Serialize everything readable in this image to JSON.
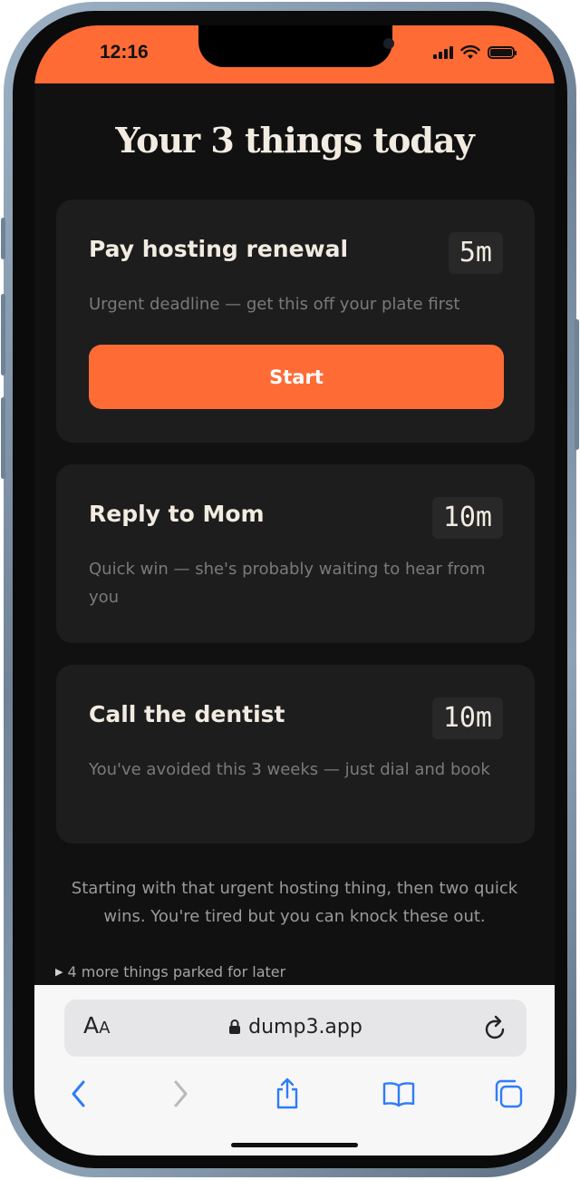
{
  "status_bar": {
    "time": "12:16",
    "color": "#ff6b35"
  },
  "page": {
    "title": "Your 3 things today",
    "accent_color": "#ff6b35",
    "tasks": [
      {
        "title": "Pay hosting renewal",
        "duration": "5m",
        "note": "Urgent deadline — get this off your plate first",
        "action": "Start"
      },
      {
        "title": "Reply to Mom",
        "duration": "10m",
        "note": "Quick win — she's probably waiting to hear from you"
      },
      {
        "title": "Call the dentist",
        "duration": "10m",
        "note": "You've avoided this 3 weeks — just dial and book"
      }
    ],
    "summary": "Starting with that urgent hosting thing, then two quick wins. You're tired but you can knock these out.",
    "parked": "4 more things parked for later"
  },
  "browser": {
    "text_size_label_big": "A",
    "text_size_label_small": "A",
    "url": "dump3.app",
    "icons": [
      "back-icon",
      "forward-icon",
      "share-icon",
      "bookmarks-icon",
      "tabs-icon",
      "reload-icon",
      "lock-icon"
    ]
  }
}
